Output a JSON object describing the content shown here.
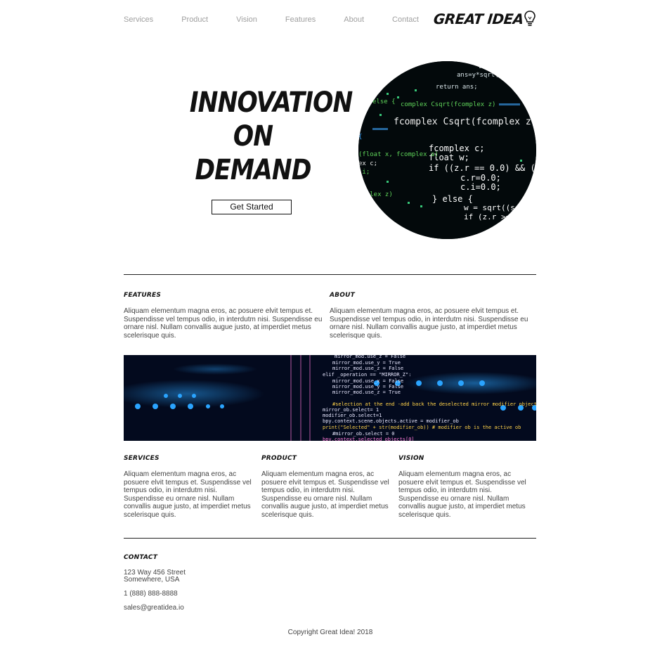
{
  "nav": {
    "links": [
      "Services",
      "Product",
      "Vision",
      "Features",
      "About",
      "Contact"
    ],
    "logo": "GREAT IDEA"
  },
  "hero": {
    "title_lines": [
      "INNOVATION",
      "ON",
      "DEMAND"
    ],
    "button": "Get Started",
    "image_icon": "code-screen-image"
  },
  "features": {
    "heading": "FEATURES",
    "body": "Aliquam elementum magna eros, ac posuere elvit tempus et. Suspendisse vel tempus odio, in interdutm nisi. Suspendisse eu ornare nisl. Nullam convallis augue justo, at imperdiet metus scelerisque quis."
  },
  "about": {
    "heading": "ABOUT",
    "body": "Aliquam elementum magna eros, ac posuere elvit tempus et. Suspendisse vel tempus odio, in interdutm nisi. Suspendisse eu ornare nisl. Nullam convallis augue justo, at imperdiet metus scelerisque quis."
  },
  "banner": {
    "image_icon": "code-banner-image"
  },
  "services": {
    "heading": "SERVICES",
    "body": "Aliquam elementum magna eros, ac posuere elvit tempus et. Suspendisse vel tempus odio, in interdutm nisi. Suspendisse eu ornare nisl. Nullam convallis augue justo, at imperdiet metus scelerisque quis."
  },
  "product": {
    "heading": "PRODUCT",
    "body": "Aliquam elementum magna eros, ac posuere elvit tempus et. Suspendisse vel tempus odio, in interdutm nisi. Suspendisse eu ornare nisl. Nullam convallis augue justo, at imperdiet metus scelerisque quis."
  },
  "vision": {
    "heading": "VISION",
    "body": "Aliquam elementum magna eros, ac posuere elvit tempus et. Suspendisse vel tempus odio, in interdutm nisi. Suspendisse eu ornare nisl. Nullam convallis augue justo, at imperdiet metus scelerisque quis."
  },
  "contact": {
    "heading": "CONTACT",
    "address1": "123 Way 456 Street",
    "address2": "Somewhere, USA",
    "phone": "1 (888) 888-8888",
    "email": "sales@greatidea.io"
  },
  "footer": {
    "copyright": "Copyright Great Idea! 2018"
  },
  "colors": {
    "text": "#333333",
    "nav_link": "#a0a0a0",
    "heading": "#111111",
    "code_green": "#3ddc84",
    "code_cyan": "#28b4ff"
  }
}
